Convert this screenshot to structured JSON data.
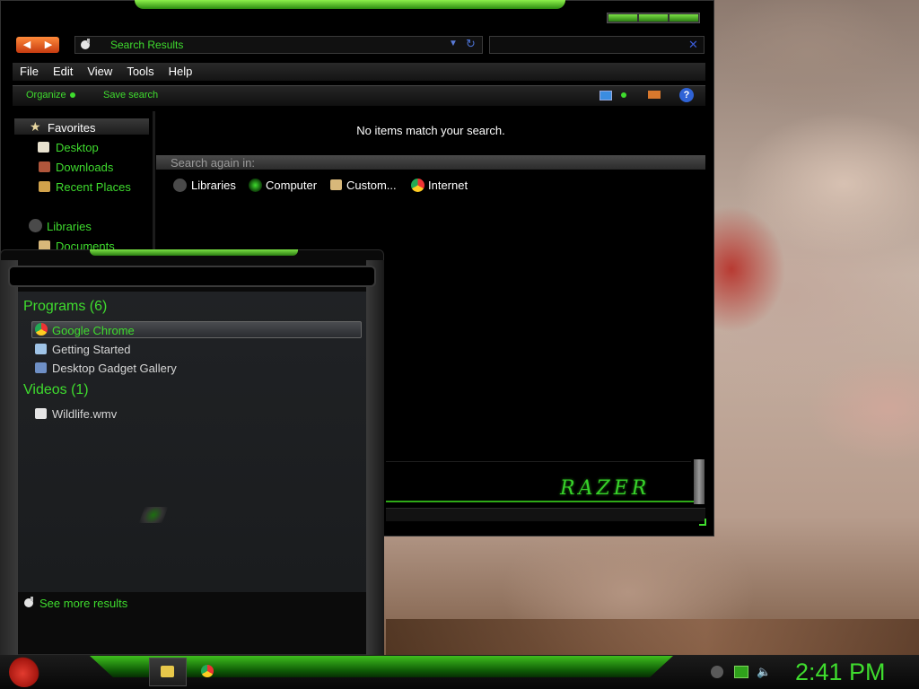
{
  "explorer": {
    "address": "Search Results",
    "menu": [
      "File",
      "Edit",
      "View",
      "Tools",
      "Help"
    ],
    "toolbar": {
      "organize": "Organize",
      "save_search": "Save search",
      "help": "?"
    },
    "nav": {
      "favorites": "Favorites",
      "favorite_items": [
        "Desktop",
        "Downloads",
        "Recent Places"
      ],
      "libraries": "Libraries",
      "library_items": [
        "Documents"
      ]
    },
    "empty_message": "No items match your search.",
    "search_again_label": "Search again in:",
    "scopes": [
      "Libraries",
      "Computer",
      "Custom...",
      "Internet"
    ],
    "brand": "RAZER"
  },
  "start_menu": {
    "groups": [
      {
        "heading": "Programs (6)",
        "items": [
          "Google Chrome",
          "Getting Started",
          "Desktop Gadget Gallery"
        ]
      },
      {
        "heading": "Videos (1)",
        "items": [
          "Wildlife.wmv"
        ]
      }
    ],
    "see_more": "See more results"
  },
  "taskbar": {
    "time": "2:41 PM"
  },
  "colors": {
    "accent": "#3fdc2e",
    "background": "#000000"
  }
}
